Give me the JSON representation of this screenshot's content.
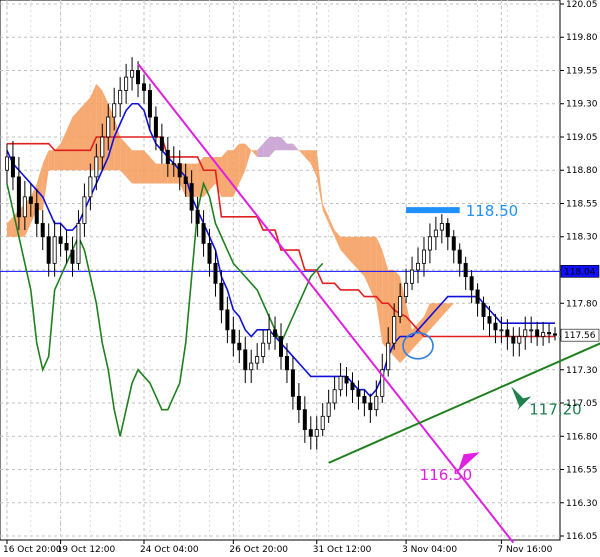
{
  "chart_data": {
    "type": "candlestick",
    "title": "",
    "xlabel": "",
    "ylabel": "",
    "ylim": [
      116.02,
      120.08
    ],
    "grid": true,
    "y_ticks": [
      "120.05",
      "119.80",
      "119.55",
      "119.30",
      "119.05",
      "118.80",
      "118.55",
      "118.30",
      "118.05",
      "117.80",
      "117.55",
      "117.30",
      "117.05",
      "116.80",
      "116.55",
      "116.30",
      "116.05"
    ],
    "x_ticks": [
      "16 Oct 20:00",
      "19 Oct 12:00",
      "24 Oct 04:00",
      "26 Oct 20:00",
      "31 Oct 12:00",
      "3 Nov 04:00",
      "7 Nov 16:00"
    ],
    "x_tick_index": [
      0,
      9,
      23,
      38,
      52,
      67,
      83
    ],
    "bar_count": 93,
    "candles": {
      "open": [
        118.8,
        118.9,
        118.75,
        118.45,
        118.6,
        118.55,
        118.4,
        118.3,
        118.1,
        118.3,
        118.25,
        118.2,
        118.1,
        118.4,
        118.6,
        118.75,
        118.9,
        119.05,
        119.2,
        119.3,
        119.4,
        119.5,
        119.55,
        119.45,
        119.4,
        119.2,
        119.05,
        118.95,
        118.85,
        118.85,
        118.75,
        118.7,
        118.5,
        118.4,
        118.25,
        118.1,
        117.95,
        117.75,
        117.6,
        117.5,
        117.45,
        117.3,
        117.35,
        117.4,
        117.5,
        117.6,
        117.55,
        117.4,
        117.3,
        117.1,
        117.0,
        116.85,
        116.8,
        116.85,
        116.95,
        117.05,
        117.15,
        117.25,
        117.2,
        117.15,
        117.1,
        117.05,
        117.0,
        117.1,
        117.3,
        117.5,
        117.7,
        117.85,
        117.95,
        118.05,
        118.1,
        118.2,
        118.3,
        118.35,
        118.4,
        118.3,
        118.2,
        118.1,
        118.0,
        117.9,
        117.8,
        117.7,
        117.65,
        117.6,
        117.6,
        117.55,
        117.5,
        117.55,
        117.6,
        117.6,
        117.55,
        117.58,
        117.57
      ],
      "close": [
        118.9,
        118.75,
        118.45,
        118.6,
        118.55,
        118.4,
        118.3,
        118.1,
        118.3,
        118.25,
        118.2,
        118.1,
        118.4,
        118.6,
        118.75,
        118.9,
        119.05,
        119.2,
        119.3,
        119.4,
        119.5,
        119.55,
        119.45,
        119.4,
        119.2,
        119.05,
        118.95,
        118.85,
        118.85,
        118.75,
        118.7,
        118.5,
        118.4,
        118.25,
        118.1,
        117.95,
        117.75,
        117.6,
        117.5,
        117.45,
        117.3,
        117.35,
        117.4,
        117.5,
        117.6,
        117.55,
        117.4,
        117.3,
        117.1,
        117.0,
        116.85,
        116.8,
        116.85,
        116.95,
        117.05,
        117.15,
        117.25,
        117.2,
        117.15,
        117.1,
        117.05,
        117.0,
        117.1,
        117.3,
        117.5,
        117.7,
        117.85,
        117.95,
        118.05,
        118.1,
        118.2,
        118.3,
        118.35,
        118.4,
        118.3,
        118.2,
        118.1,
        118.0,
        117.9,
        117.8,
        117.7,
        117.65,
        117.6,
        117.6,
        117.55,
        117.5,
        117.55,
        117.6,
        117.6,
        117.55,
        117.58,
        117.57,
        117.56
      ],
      "high": [
        119.0,
        119.02,
        118.9,
        118.72,
        118.7,
        118.66,
        118.5,
        118.4,
        118.42,
        118.4,
        118.35,
        118.3,
        118.5,
        118.7,
        118.85,
        119.0,
        119.15,
        119.3,
        119.42,
        119.5,
        119.6,
        119.65,
        119.62,
        119.52,
        119.45,
        119.28,
        119.15,
        119.05,
        118.98,
        118.95,
        118.85,
        118.8,
        118.6,
        118.5,
        118.36,
        118.2,
        118.05,
        117.85,
        117.7,
        117.6,
        117.55,
        117.45,
        117.5,
        117.6,
        117.72,
        117.7,
        117.65,
        117.5,
        117.4,
        117.2,
        117.1,
        116.95,
        116.95,
        117.05,
        117.15,
        117.25,
        117.35,
        117.32,
        117.28,
        117.22,
        117.15,
        117.12,
        117.22,
        117.42,
        117.62,
        117.8,
        117.95,
        118.06,
        118.15,
        118.22,
        118.3,
        118.4,
        118.45,
        118.47,
        118.44,
        118.35,
        118.25,
        118.15,
        118.05,
        117.95,
        117.85,
        117.78,
        117.72,
        117.7,
        117.68,
        117.62,
        117.62,
        117.7,
        117.7,
        117.66,
        117.66,
        117.65,
        117.62
      ],
      "low": [
        118.7,
        118.65,
        118.35,
        118.35,
        118.45,
        118.3,
        118.2,
        118.0,
        118.0,
        118.15,
        118.1,
        118.0,
        118.05,
        118.3,
        118.5,
        118.65,
        118.8,
        118.95,
        119.1,
        119.2,
        119.3,
        119.4,
        119.35,
        119.3,
        119.1,
        118.95,
        118.85,
        118.75,
        118.75,
        118.65,
        118.6,
        118.4,
        118.3,
        118.15,
        118.0,
        117.85,
        117.65,
        117.5,
        117.4,
        117.35,
        117.2,
        117.2,
        117.3,
        117.35,
        117.45,
        117.45,
        117.3,
        117.2,
        117.0,
        116.9,
        116.75,
        116.7,
        116.7,
        116.8,
        116.9,
        117.0,
        117.1,
        117.1,
        117.05,
        117.0,
        116.95,
        116.9,
        116.95,
        117.05,
        117.25,
        117.45,
        117.65,
        117.8,
        117.9,
        117.95,
        118.0,
        118.1,
        118.2,
        118.25,
        118.2,
        118.1,
        118.0,
        117.9,
        117.8,
        117.7,
        117.6,
        117.55,
        117.5,
        117.5,
        117.45,
        117.4,
        117.4,
        117.45,
        117.5,
        117.48,
        117.48,
        117.5,
        117.52
      ]
    },
    "series": [
      {
        "color": "#e02020",
        "values": [
          119.0,
          119.0,
          119.0,
          119.0,
          119.0,
          119.0,
          119.0,
          119.0,
          118.95,
          118.95,
          118.95,
          118.95,
          118.95,
          118.95,
          118.95,
          119.05,
          119.05,
          119.05,
          119.05,
          119.05,
          119.05,
          119.05,
          119.05,
          119.05,
          119.05,
          119.05,
          119.05,
          118.9,
          118.9,
          118.9,
          118.9,
          118.9,
          118.9,
          118.8,
          118.8,
          118.8,
          118.45,
          118.45,
          118.45,
          118.45,
          118.45,
          118.45,
          118.45,
          118.35,
          118.35,
          118.35,
          118.2,
          118.2,
          118.2,
          118.2,
          118.05,
          118.05,
          118.05,
          117.95,
          117.95,
          117.95,
          117.9,
          117.9,
          117.9,
          117.9,
          117.85,
          117.85,
          117.85,
          117.8,
          117.8,
          117.75,
          117.72,
          117.7,
          117.65,
          117.6,
          117.55,
          117.55,
          117.55,
          117.55,
          117.55,
          117.55,
          117.55,
          117.55,
          117.55,
          117.55,
          117.55,
          117.55,
          117.55,
          117.55,
          117.55,
          117.55,
          117.55,
          117.55,
          117.55,
          117.55,
          117.55,
          117.55,
          117.55
        ]
      },
      {
        "color": "#1010dd",
        "values": [
          118.95,
          118.85,
          118.8,
          118.75,
          118.7,
          118.65,
          118.6,
          118.5,
          118.4,
          118.4,
          118.35,
          118.35,
          118.4,
          118.5,
          118.6,
          118.7,
          118.8,
          118.9,
          119.05,
          119.15,
          119.25,
          119.3,
          119.3,
          119.25,
          119.1,
          119.0,
          118.95,
          118.9,
          118.85,
          118.8,
          118.75,
          118.6,
          118.5,
          118.4,
          118.3,
          118.2,
          118.0,
          117.9,
          117.75,
          117.7,
          117.6,
          117.55,
          117.6,
          117.6,
          117.6,
          117.55,
          117.5,
          117.45,
          117.4,
          117.35,
          117.3,
          117.25,
          117.25,
          117.25,
          117.25,
          117.25,
          117.25,
          117.25,
          117.2,
          117.15,
          117.15,
          117.1,
          117.15,
          117.25,
          117.4,
          117.5,
          117.55,
          117.55,
          117.55,
          117.6,
          117.65,
          117.7,
          117.75,
          117.8,
          117.85,
          117.85,
          117.85,
          117.85,
          117.85,
          117.85,
          117.8,
          117.75,
          117.7,
          117.65,
          117.65,
          117.65,
          117.65,
          117.65,
          117.65,
          117.65,
          117.65,
          117.65,
          117.65
        ]
      },
      {
        "color": "#208020",
        "values": [
          118.7,
          118.5,
          118.3,
          118.1,
          117.9,
          117.5,
          117.3,
          117.4,
          117.9,
          118.0,
          118.1,
          118.2,
          118.3,
          118.2,
          118.0,
          117.8,
          117.5,
          117.3,
          117.0,
          116.8,
          117.0,
          117.2,
          117.3,
          117.25,
          117.2,
          117.1,
          117.0,
          117.0,
          117.1,
          117.2,
          117.5,
          118.0,
          118.5,
          118.7,
          118.6,
          118.4,
          118.3,
          118.2,
          118.1,
          118.05,
          118.0,
          117.95,
          117.9,
          117.8,
          117.7,
          117.6,
          117.5,
          117.6,
          117.7,
          117.8,
          117.9,
          118.0,
          118.05,
          118.1
        ]
      }
    ],
    "kumo": {
      "span_a": [
        118.4,
        118.45,
        118.5,
        118.55,
        118.6,
        118.7,
        118.85,
        118.95,
        118.95,
        119.0,
        119.1,
        119.2,
        119.25,
        119.3,
        119.35,
        119.45,
        119.4,
        119.3,
        119.2,
        119.05,
        119.0,
        118.95,
        118.95,
        118.95,
        118.9,
        118.85,
        118.85,
        118.85,
        118.85,
        118.85,
        118.85,
        118.85,
        118.85,
        118.9,
        118.9,
        118.9,
        118.9,
        118.95,
        118.95,
        119.0,
        119.0,
        118.95,
        118.9,
        118.9,
        118.9,
        118.95,
        118.95,
        118.95,
        118.95,
        118.95,
        118.95,
        118.95,
        118.95,
        118.55,
        118.45,
        118.35,
        118.3,
        118.3,
        118.3,
        118.3,
        118.3,
        118.3,
        118.3,
        118.2,
        118.05,
        118.05,
        118.0,
        117.8,
        117.6,
        117.65,
        117.7,
        117.8,
        117.8,
        117.8,
        117.8,
        117.8,
        117.8,
        117.8,
        117.8,
        117.8,
        117.8,
        117.8
      ],
      "span_b": [
        118.3,
        118.3,
        118.3,
        118.3,
        118.4,
        118.5,
        118.5,
        118.8,
        118.8,
        118.8,
        118.8,
        118.8,
        118.8,
        118.8,
        118.8,
        118.8,
        118.8,
        118.8,
        118.8,
        118.8,
        118.75,
        118.7,
        118.7,
        118.7,
        118.7,
        118.7,
        118.7,
        118.7,
        118.7,
        118.7,
        118.6,
        118.6,
        118.6,
        118.6,
        118.65,
        118.7,
        118.6,
        118.6,
        118.6,
        118.7,
        118.8,
        118.95,
        118.95,
        119.0,
        119.05,
        119.05,
        119.05,
        119.0,
        119.0,
        118.95,
        118.9,
        118.85,
        118.75,
        118.5,
        118.4,
        118.3,
        118.2,
        118.15,
        118.1,
        118.05,
        118.0,
        117.9,
        117.8,
        117.5,
        117.45,
        117.4,
        117.35,
        117.4,
        117.45,
        117.5,
        117.55,
        117.6,
        117.65,
        117.7,
        117.75,
        117.8,
        117.8,
        117.8,
        117.8,
        117.8,
        117.8,
        117.8
      ],
      "start_index": 0,
      "color_bull": "#f5a060",
      "color_bear": "#c8a0d0"
    },
    "hline": {
      "value": 118.04,
      "color": "#1010ff"
    },
    "current_price": 117.56,
    "labels": {
      "hline_tag": "118.04",
      "price_tag": "117.56",
      "level_1850": "118.50",
      "level_1720": "117.20",
      "level_1650": "116.50"
    },
    "trendlines": [
      {
        "name": "downtrend",
        "color": "#e020e0",
        "x1": 22,
        "y1": 119.6,
        "x2": 85,
        "y2": 116.0
      },
      {
        "name": "uptrend",
        "color": "#208020",
        "x1": 54,
        "y1": 116.6,
        "x2": 120,
        "y2": 117.9
      }
    ],
    "marker_level": {
      "value": 118.5,
      "color": "#1e90ff",
      "x_from": 67,
      "x_to": 76
    },
    "ellipse": {
      "x": 69,
      "y": 117.48,
      "color": "#3080e0"
    },
    "arrows": [
      {
        "color": "#208050",
        "x": 87,
        "y": 117.1
      },
      {
        "color": "#e020e0",
        "x": 77,
        "y": 116.65
      }
    ]
  }
}
